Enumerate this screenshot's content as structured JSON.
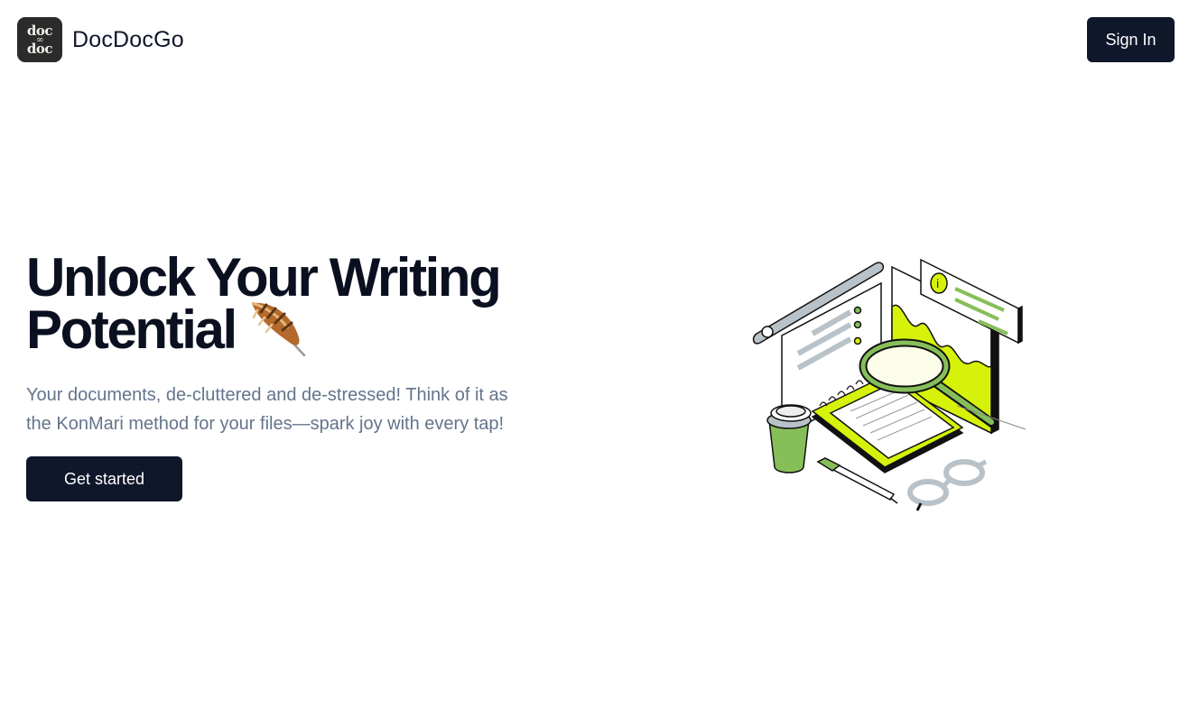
{
  "header": {
    "logo_icon": "doc-doc-logo-icon",
    "brand_name": "DocDocGo",
    "sign_in_label": "Sign In"
  },
  "hero": {
    "title_line1": "Unlock Your Writing",
    "title_line2": "Potential",
    "title_icon": "feather-icon",
    "subtitle_line1": "Your documents, de-cluttered and de-stressed! Think of it as",
    "subtitle_line2": "the KonMari method for your files—spark joy with every tap!",
    "cta_label": "Get started"
  },
  "illustration": {
    "icon": "documents-magnifier-illustration",
    "colors": {
      "accent": "#d6f20a",
      "green": "#86bf5a",
      "stroke": "#111111",
      "grey": "#b8c2c8"
    }
  },
  "colors": {
    "primary": "#0f172a",
    "muted_text": "#64748b",
    "background": "#ffffff"
  }
}
